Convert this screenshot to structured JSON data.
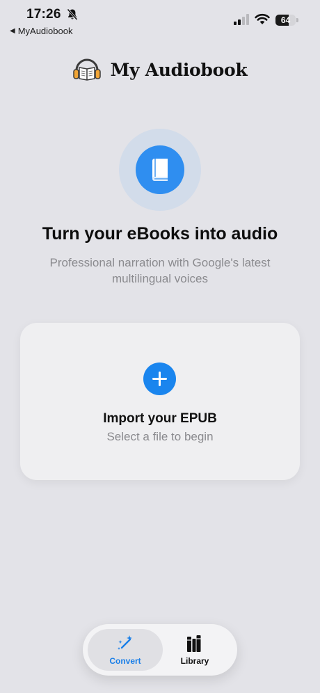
{
  "status_bar": {
    "time": "17:26",
    "back_app": "MyAudiobook",
    "battery_level": "64",
    "icons": [
      "bell-slash-icon",
      "cellular-signal-icon",
      "wifi-icon",
      "battery-icon"
    ]
  },
  "header": {
    "title": "My Audiobook",
    "logo_icon": "headphones-book-icon"
  },
  "hero": {
    "icon": "book-icon",
    "headline": "Turn your eBooks into audio",
    "subline": "Professional narration with Google's latest multilingual voices"
  },
  "import_card": {
    "icon": "plus-icon",
    "title": "Import your EPUB",
    "subtitle": "Select a file to begin"
  },
  "tab_bar": {
    "tabs": [
      {
        "label": "Convert",
        "icon": "magic-wand-icon",
        "selected": true
      },
      {
        "label": "Library",
        "icon": "books-icon",
        "selected": false
      }
    ]
  },
  "colors": {
    "accent": "#1a85ee",
    "background": "#e3e3e8",
    "secondary_text": "#8a8a8e"
  }
}
